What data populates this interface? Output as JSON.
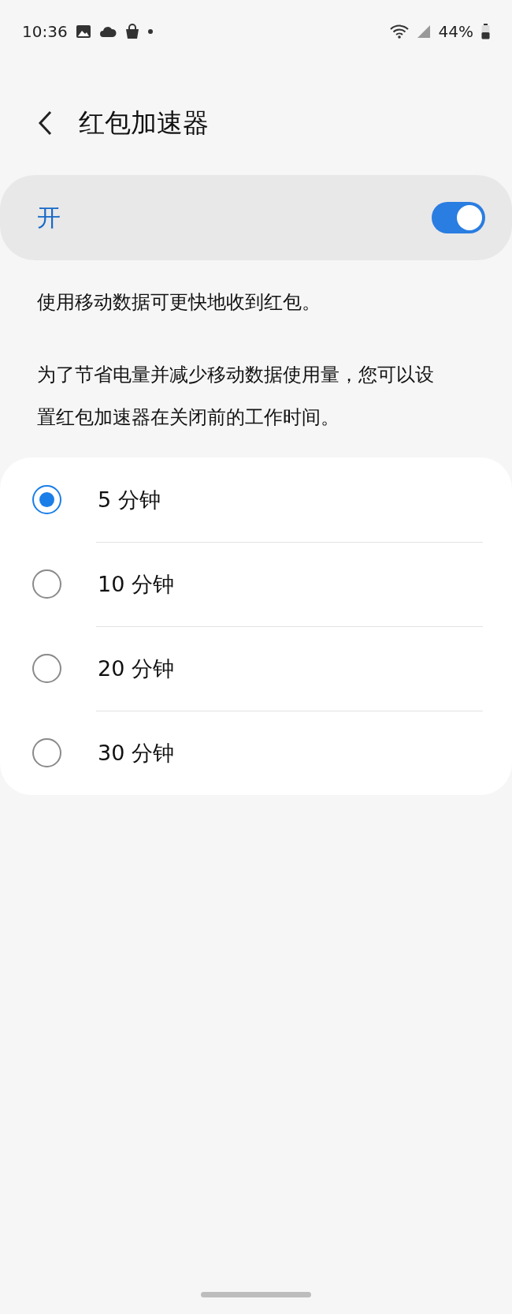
{
  "status_bar": {
    "time": "10:36",
    "battery": "44%"
  },
  "header": {
    "title": "红包加速器"
  },
  "master_switch": {
    "label": "开",
    "on": true
  },
  "descriptions": [
    "使用移动数据可更快地收到红包。",
    "为了节省电量并减少移动数据使用量，您可以设置红包加速器在关闭前的工作时间。"
  ],
  "options": [
    {
      "label": "5 分钟",
      "selected": true
    },
    {
      "label": "10 分钟",
      "selected": false
    },
    {
      "label": "20 分钟",
      "selected": false
    },
    {
      "label": "30 分钟",
      "selected": false
    }
  ]
}
